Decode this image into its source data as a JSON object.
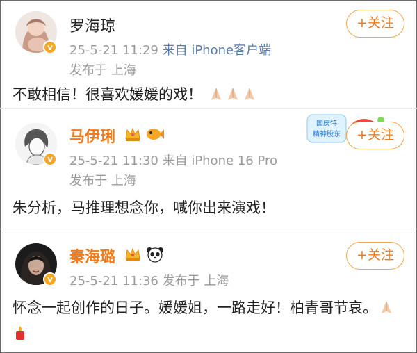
{
  "posts": [
    {
      "name": "罗海琼",
      "time": "25-5-21 11:29",
      "source": "来自 iPhone客户端",
      "location": "发布于 上海",
      "follow_label": "+关注",
      "text": "不敢相信！很喜欢媛媛的戏！",
      "emojis": [
        "pray-emoji",
        "pray-emoji",
        "pray-emoji"
      ]
    },
    {
      "name": "马伊琍",
      "time": "25-5-21 11:30",
      "source": "来自 iPhone 16 Pro",
      "location": "发布于 上海",
      "follow_label": "+关注",
      "text": "朱分析，马推理想念你，喊你出来演戏！",
      "badges": [
        "crown-icon",
        "fish-icon"
      ],
      "sticker_text": "国庆特 精神股东"
    },
    {
      "name": "秦海璐",
      "time": "25-5-21 11:36",
      "location": "发布于 上海",
      "follow_label": "+关注",
      "text": "怀念一起创作的日子。媛媛姐，一路走好！柏青哥节哀。",
      "badges": [
        "crown-icon",
        "panda-icon"
      ],
      "emojis": [
        "pray-emoji",
        "candle-emoji"
      ]
    }
  ],
  "colors": {
    "accent": "#f07b1e",
    "follow_border": "#f3a64a",
    "meta": "#9a9a9a",
    "source_link": "#5b7aa6",
    "verified": "#f5a623"
  }
}
